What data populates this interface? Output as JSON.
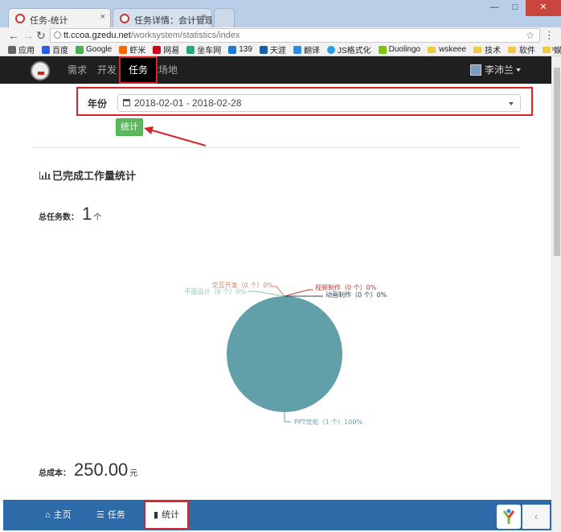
{
  "browser": {
    "tabs": [
      {
        "title": "任务-统计",
        "close": "×"
      },
      {
        "title": "任务详情：会计管理模板",
        "close": "×"
      }
    ],
    "window_buttons": [
      "—",
      "□",
      "✕"
    ],
    "url_host": "tt.ccoa.gzedu.net",
    "url_path": "/worksystem/statistics/index",
    "bookmarks": [
      {
        "label": "应用",
        "color": "#666"
      },
      {
        "label": "百度",
        "color": "#2d5be3"
      },
      {
        "label": "Google",
        "color": "#4caf50"
      },
      {
        "label": "虾米",
        "color": "#f60"
      },
      {
        "label": "网易",
        "color": "#d0021b"
      },
      {
        "label": "坐车网",
        "color": "#2a7"
      },
      {
        "label": "139",
        "color": "#1c7ad1"
      },
      {
        "label": "天涯",
        "color": "#1a5fae"
      },
      {
        "label": "翻译",
        "color": "#2b8ee0"
      },
      {
        "label": "JS格式化",
        "color": "#27a1e6"
      },
      {
        "label": "Duolingo",
        "color": "#7ac70c"
      }
    ],
    "folders": [
      "wskeee",
      "技术",
      "软件",
      "娱乐"
    ],
    "more": "»"
  },
  "navbar": {
    "items": [
      "需求",
      "开发",
      "任务",
      "场地"
    ],
    "user": "李沛兰"
  },
  "filter": {
    "label": "年份",
    "date_range": "2018-02-01 - 2018-02-28",
    "submit": "统计"
  },
  "stats": {
    "section_title": "已完成工作量统计",
    "total_tasks_label": "总任务数：",
    "total_tasks_value": "1",
    "total_tasks_unit": "个",
    "total_cost_label": "总成本：",
    "total_cost_value": "250.00",
    "total_cost_unit": "元"
  },
  "chart_data": {
    "type": "pie",
    "title": "",
    "slices": [
      {
        "label": "PPT优化（1 个）100%",
        "value": 1,
        "percent": 100,
        "color": "#61a0a8"
      },
      {
        "label": "平面设计（0 个）0%",
        "value": 0,
        "percent": 0,
        "color": "#91c7ae"
      },
      {
        "label": "交互开发（0 个）0%",
        "value": 0,
        "percent": 0,
        "color": "#d48265"
      },
      {
        "label": "视频制作（0 个）0%",
        "value": 0,
        "percent": 0,
        "color": "#c23531"
      },
      {
        "label": "动画制作（0 个）0%",
        "value": 0,
        "percent": 0,
        "color": "#2f4554"
      }
    ]
  },
  "bottom_nav": {
    "items": [
      {
        "label": "主页",
        "icon": "home-icon"
      },
      {
        "label": "任务",
        "icon": "list-icon"
      },
      {
        "label": "统计",
        "icon": "bar-chart-icon"
      }
    ],
    "back": "‹"
  },
  "colors": {
    "highlight": "#d9232a",
    "submit": "#5cb85c",
    "bottom_bar": "#2c6aa8",
    "navbar": "#1f1f1f"
  }
}
